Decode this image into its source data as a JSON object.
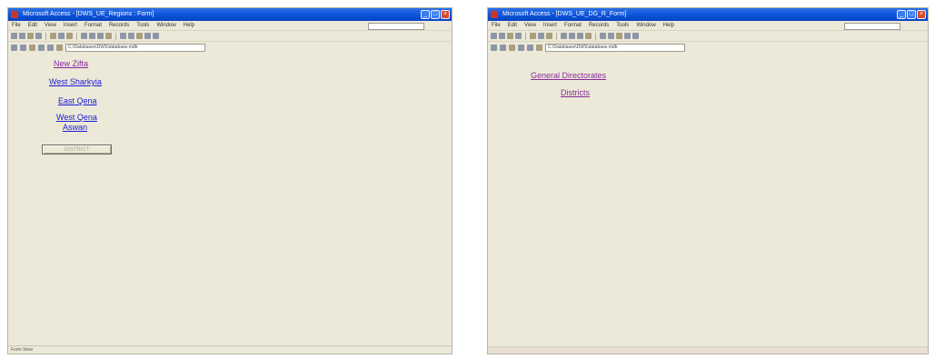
{
  "left": {
    "title": "Microsoft Access - [DWS_UE_Regions : Form]",
    "menu": [
      "File",
      "Edit",
      "View",
      "Insert",
      "Format",
      "Records",
      "Tools",
      "Window",
      "Help"
    ],
    "address": "C:\\Databases\\DWS\\database.mdb",
    "links": {
      "new_zifta": "New Zifta",
      "west_sharkyia": "West Sharkyia",
      "east_qena": "East Qena",
      "west_qena": "West Qena",
      "aswan": "Aswan"
    },
    "button_label": "DISTRICT",
    "status": "Form View"
  },
  "right": {
    "title": "Microsoft Access - [DWS_UE_DG_R_Form]",
    "menu": [
      "File",
      "Edit",
      "View",
      "Insert",
      "Format",
      "Records",
      "Tools",
      "Window",
      "Help"
    ],
    "address": "C:\\Databases\\DWS\\database.mdb",
    "links": {
      "general_directorates": "General Directorates",
      "districts": "Districts"
    }
  }
}
